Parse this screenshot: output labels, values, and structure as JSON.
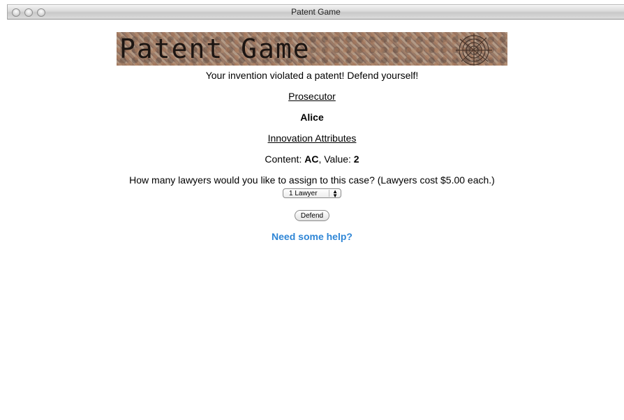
{
  "window": {
    "title": "Patent Game"
  },
  "banner": {
    "text": "Patent Game"
  },
  "main": {
    "message": "Your invention violated a patent! Defend yourself!",
    "prosecutor_heading": "Prosecutor",
    "prosecutor_name": "Alice",
    "attributes_heading": "Innovation Attributes",
    "content_label": "Content: ",
    "content_value": "AC",
    "value_label": ", Value: ",
    "value_value": "2",
    "lawyers_question": "How many lawyers would you like to assign to this case? (Lawyers cost $5.00 each.)",
    "lawyers_selected": "1 Lawyer",
    "defend_label": "Defend",
    "help_link": "Need some help?"
  },
  "colors": {
    "link": "#2f86d6"
  }
}
